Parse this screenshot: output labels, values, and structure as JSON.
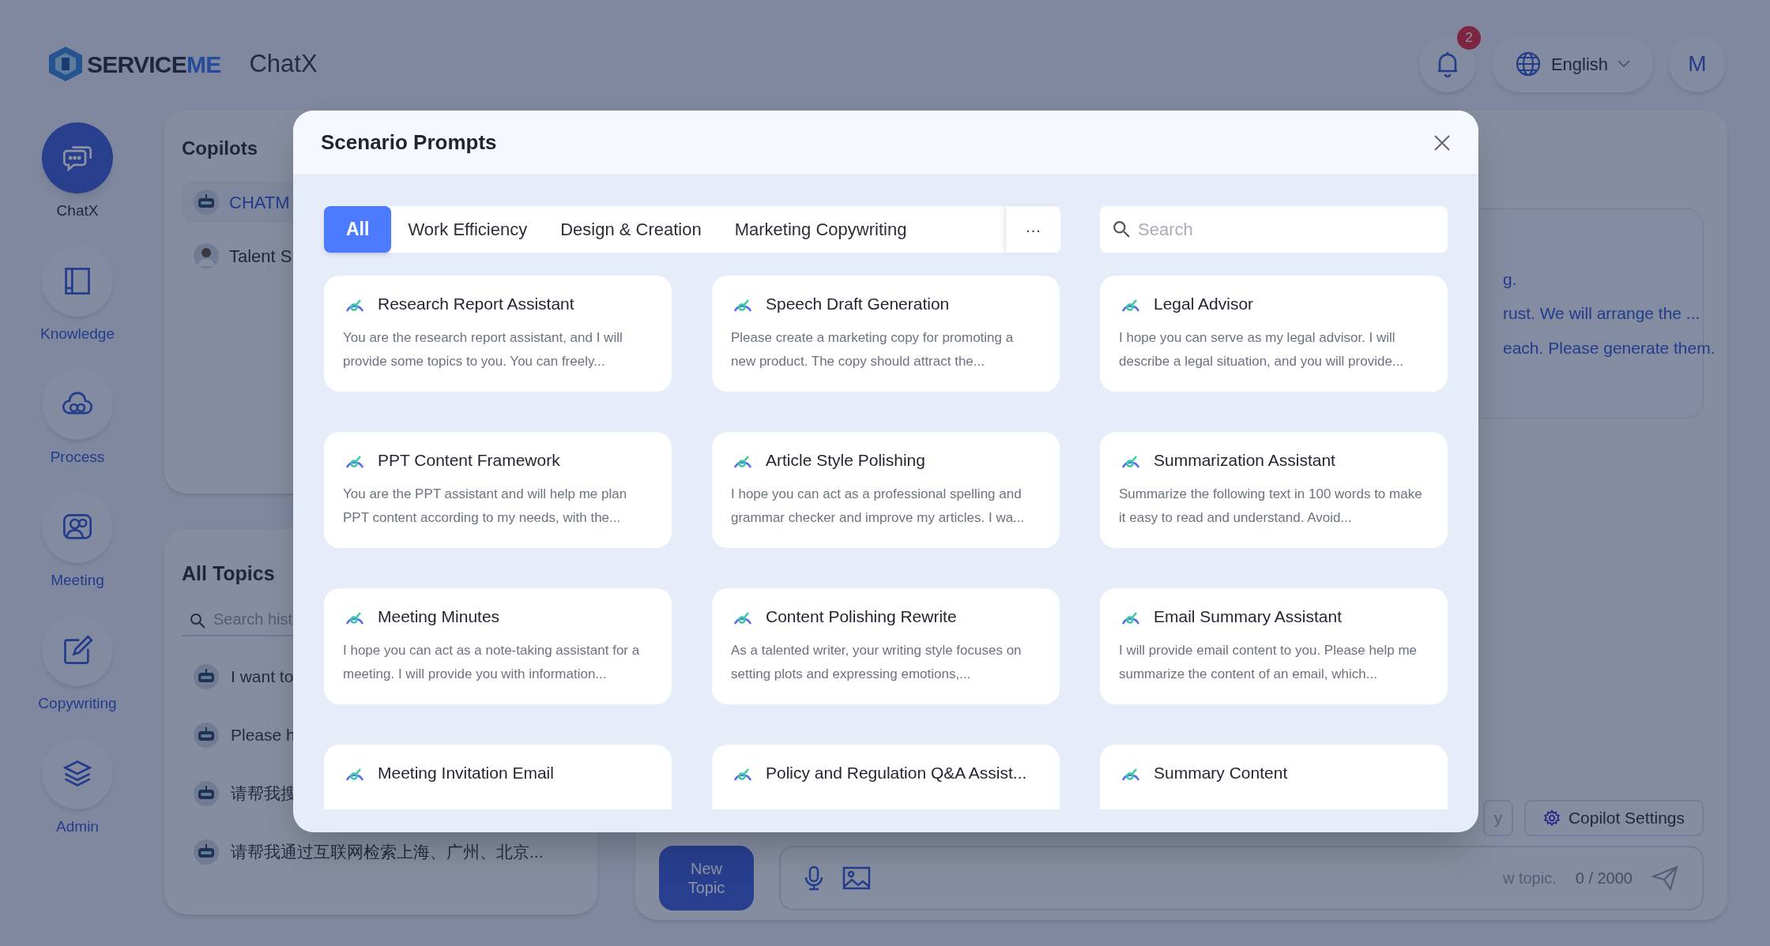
{
  "header": {
    "logo_main": "SERVICE",
    "logo_accent": "ME",
    "app_name": "ChatX",
    "notification_count": "2",
    "language": "English",
    "avatar": "M"
  },
  "nav": [
    {
      "label": "ChatX",
      "kind": "chat",
      "selected": true
    },
    {
      "label": "Knowledge",
      "kind": "book",
      "selected": false
    },
    {
      "label": "Process",
      "kind": "cloud",
      "selected": false
    },
    {
      "label": "Meeting",
      "kind": "people",
      "selected": false
    },
    {
      "label": "Copywriting",
      "kind": "edit",
      "selected": false
    },
    {
      "label": "Admin",
      "kind": "layers",
      "selected": false
    }
  ],
  "copilots": {
    "title": "Copilots",
    "items": [
      {
        "name": "CHATM",
        "kind": "robot",
        "selected": true
      },
      {
        "name": "Talent S",
        "kind": "person",
        "selected": false
      }
    ]
  },
  "topics": {
    "title": "All Topics",
    "search": {
      "placeholder": "Search hist"
    },
    "items": [
      "I want to",
      "Please h",
      "请帮我搜",
      "请帮我通过互联网检索上海、广州、北京..."
    ]
  },
  "chat": {
    "message_lines": [
      "g.",
      "rust. We will arrange the ...",
      "each. Please generate them."
    ],
    "partial_button": "y",
    "settings_button": "Copilot Settings",
    "new_topic": "New Topic",
    "input": {
      "placeholder": "w topic."
    },
    "counter": "0 / 2000"
  },
  "modal": {
    "title": "Scenario Prompts",
    "tabs": [
      {
        "label": "All",
        "selected": true
      },
      {
        "label": "Work Efficiency",
        "selected": false
      },
      {
        "label": "Design & Creation",
        "selected": false
      },
      {
        "label": "Marketing Copywriting",
        "selected": false
      }
    ],
    "more": "···",
    "search": {
      "placeholder": "Search"
    },
    "cards": [
      {
        "title": "Research Report Assistant",
        "description": "You are the research report assistant, and I will provide some topics to you. You can freely..."
      },
      {
        "title": "Speech Draft Generation",
        "description": "Please create a marketing copy for promoting a new product. The copy should attract the..."
      },
      {
        "title": "Legal Advisor",
        "description": "I hope you can serve as my legal advisor. I will describe a legal situation, and you will provide..."
      },
      {
        "title": "PPT Content Framework",
        "description": "You are the PPT assistant and will help me plan PPT content according to my needs, with the..."
      },
      {
        "title": "Article Style Polishing",
        "description": "I hope you can act as a professional spelling and grammar checker and improve my articles. I wa..."
      },
      {
        "title": "Summarization Assistant",
        "description": "Summarize the following text in 100 words to make it easy to read and understand. Avoid..."
      },
      {
        "title": "Meeting Minutes",
        "description": "I hope you can act as a note-taking assistant for a meeting. I will provide you with information..."
      },
      {
        "title": "Content Polishing Rewrite",
        "description": "As a talented writer, your writing style focuses on setting plots and expressing emotions,..."
      },
      {
        "title": "Email Summary Assistant",
        "description": "I will provide email content to you. Please help me summarize the content of an email, which..."
      },
      {
        "title": "Meeting Invitation Email"
      },
      {
        "title": "Policy and Regulation Q&A Assist..."
      },
      {
        "title": "Summary Content"
      }
    ]
  }
}
